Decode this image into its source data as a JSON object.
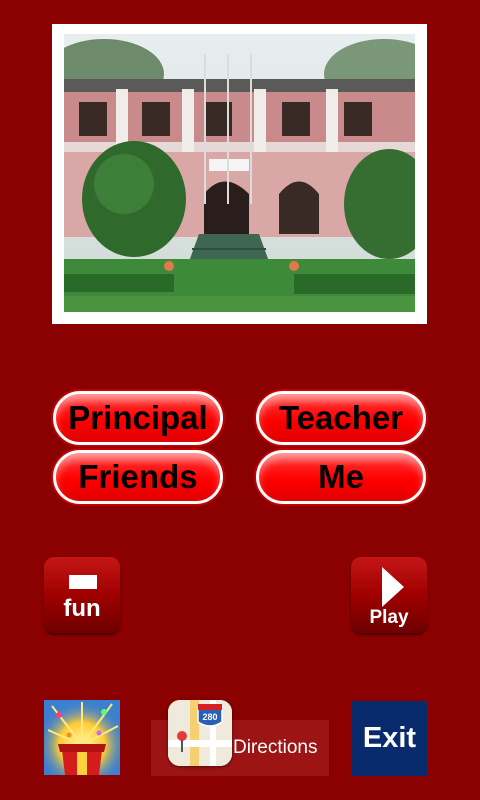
{
  "buttons": {
    "principal": "Principal",
    "teacher": "Teacher",
    "friends": "Friends",
    "me": "Me"
  },
  "side_buttons": {
    "fun": "fun",
    "play": "Play"
  },
  "bottom": {
    "directions": "Directions",
    "highway_number": "280",
    "exit": "Exit"
  },
  "colors": {
    "background": "#8b0000",
    "pill_red": "#ff0000",
    "exit_blue": "#0a2a6e"
  }
}
